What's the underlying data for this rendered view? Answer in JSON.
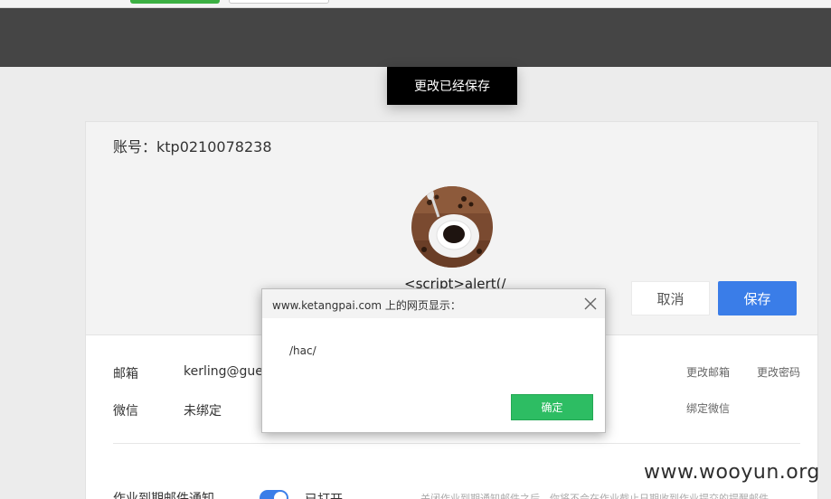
{
  "toast": {
    "text": "更改已经保存"
  },
  "profile": {
    "account_label": "账号：ktp0210078238",
    "nickname": "<script>alert(/",
    "cancel_label": "取消",
    "save_label": "保存"
  },
  "contact": {
    "email_label": "邮箱",
    "email_value": "kerling@gue",
    "change_email_label": "更改邮箱",
    "change_password_label": "更改密码",
    "wechat_label": "微信",
    "wechat_value": "未绑定",
    "bind_wechat_label": "绑定微信"
  },
  "notification": {
    "label": "作业到期邮件通知",
    "status": "已打开",
    "description": "关闭作业到期通知邮件之后，你将不会在作业截止日期收到作业提交的提醒邮件"
  },
  "dialog": {
    "title": "www.ketangpai.com 上的网页显示：",
    "message": "/hac/",
    "ok_label": "确定"
  },
  "watermark": "www.wooyun.org",
  "colors": {
    "primary": "#3a7de8",
    "ok_green": "#2dbd63",
    "toast_bg": "#000000"
  }
}
